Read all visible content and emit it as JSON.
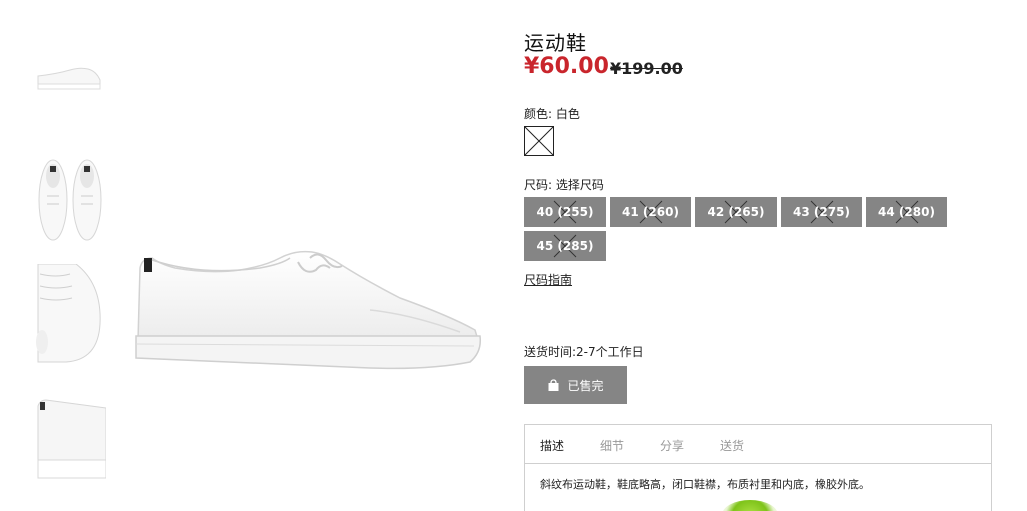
{
  "product": {
    "title": "运动鞋",
    "price": "¥60.00",
    "original_price": "¥199.00"
  },
  "color": {
    "label": "颜色: 白色",
    "swatch_name": "white"
  },
  "size": {
    "label": "尺码: 选择尺码",
    "options": [
      "40 (255)",
      "41 (260)",
      "42 (265)",
      "43 (275)",
      "44 (280)",
      "45 (285)"
    ],
    "all_unavailable": true
  },
  "size_guide": "尺码指南",
  "delivery": "送货时间:2-7个工作日",
  "cart_button": {
    "label": "已售完",
    "icon": "shopping-bag-icon"
  },
  "tabs": [
    "描述",
    "细节",
    "分享",
    "送货"
  ],
  "active_tab": "描述",
  "description": "斜纹布运动鞋，鞋底略高，闭口鞋襟，布质衬里和内底，橡胶外底。",
  "colors": {
    "price": "#c9252c",
    "button_gray": "#858585",
    "border": "#cfcfcf"
  }
}
